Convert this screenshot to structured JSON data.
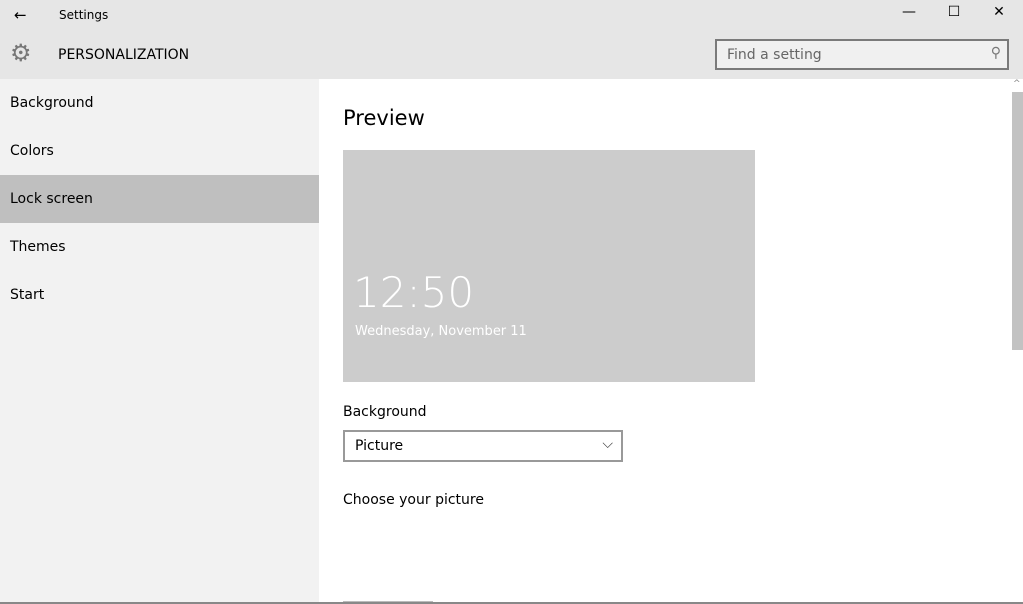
{
  "window": {
    "title": "Settings",
    "back": "←",
    "minimize": "—",
    "maximize": "☐",
    "close": "✕"
  },
  "header": {
    "section": "PERSONALIZATION",
    "search_placeholder": "Find a setting"
  },
  "sidebar": {
    "items": [
      {
        "label": "Background"
      },
      {
        "label": "Colors"
      },
      {
        "label": "Lock screen",
        "selected": true
      },
      {
        "label": "Themes"
      },
      {
        "label": "Start"
      }
    ]
  },
  "main": {
    "preview_title": "Preview",
    "time": "12:50",
    "date": "Wednesday, November 11",
    "background_label": "Background",
    "background_value": "Picture",
    "choose_label": "Choose your picture"
  },
  "colors": {
    "selected": "#bfbfbf",
    "sidebar": "#f2f2f2",
    "preview": "#cccccc"
  }
}
